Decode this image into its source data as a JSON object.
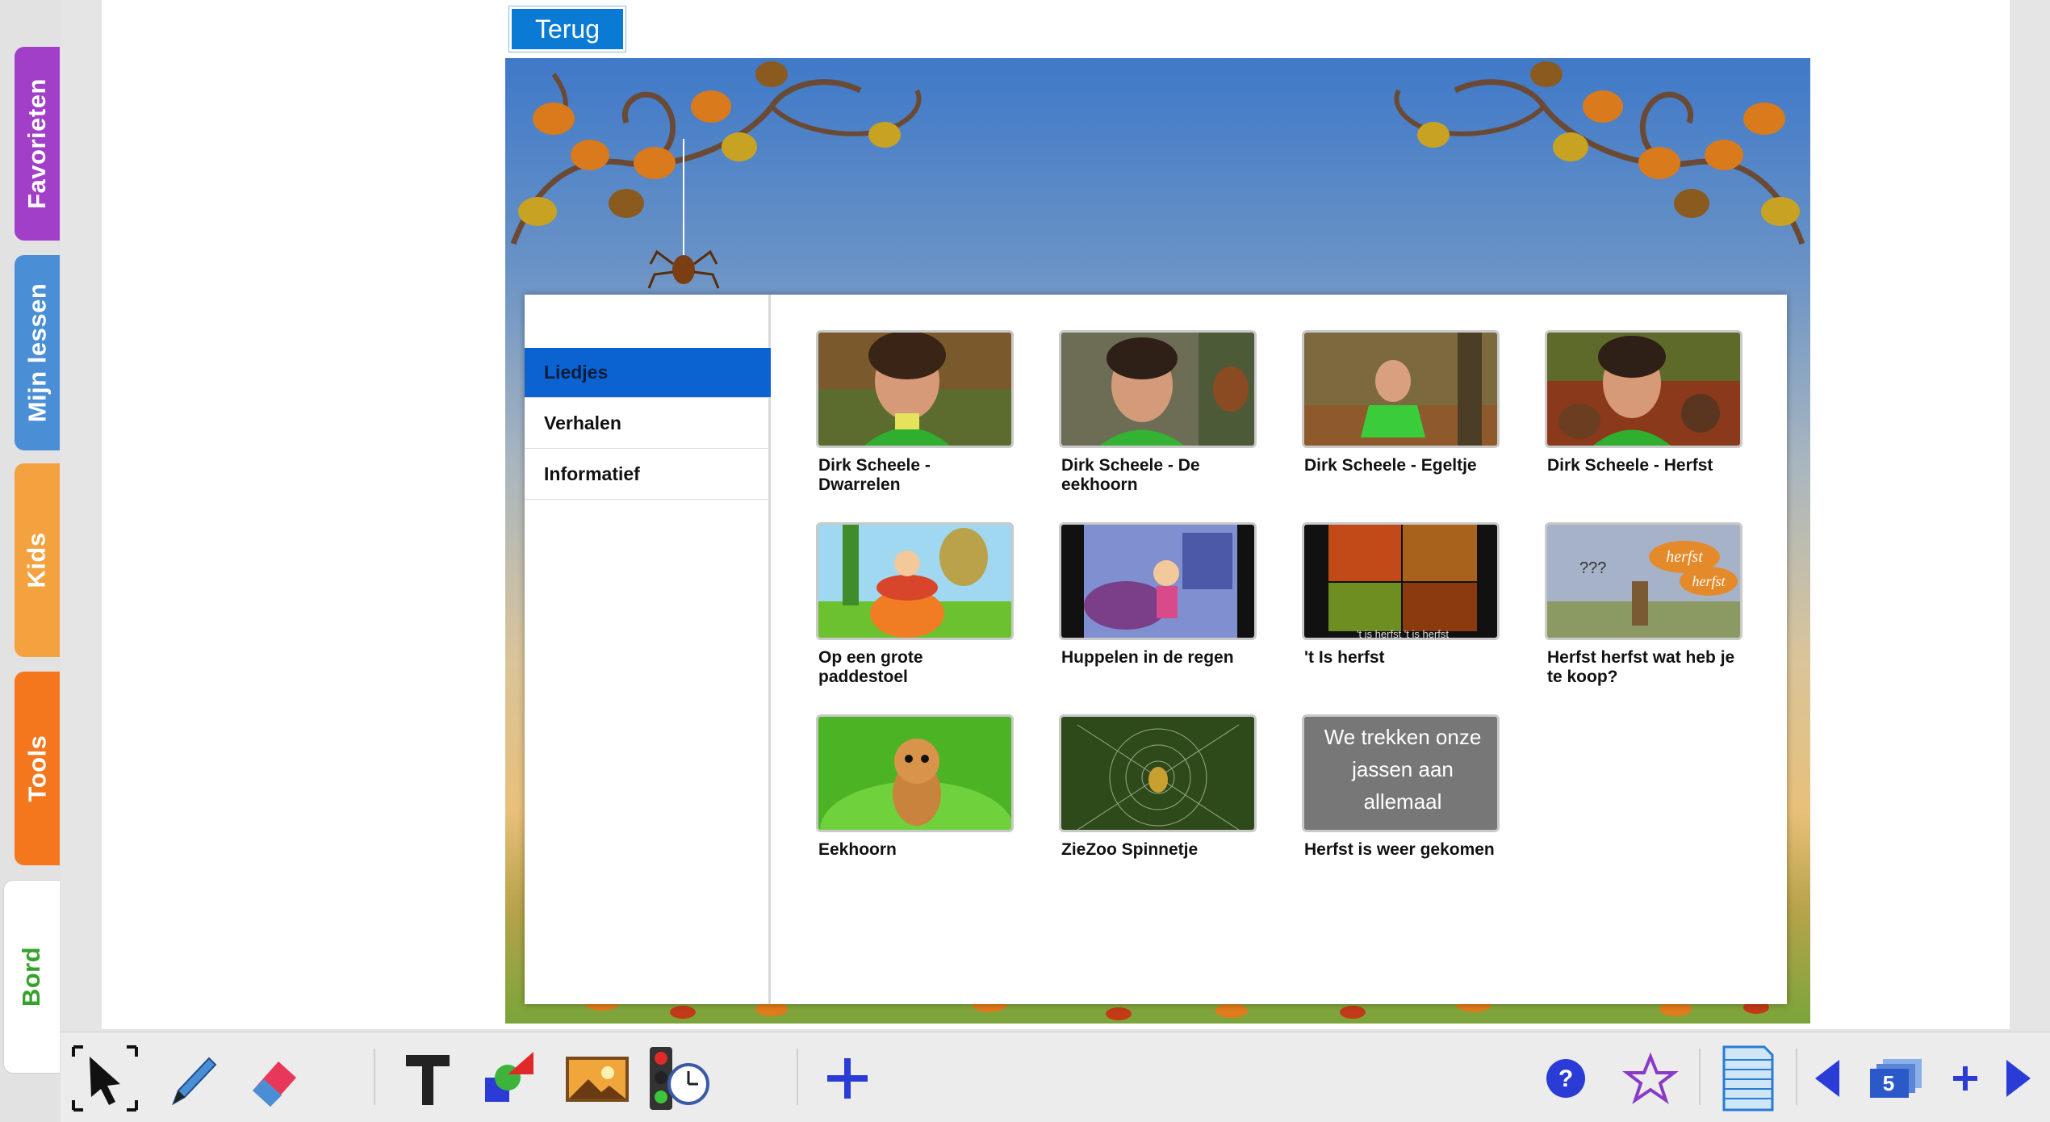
{
  "side_tabs": [
    {
      "label": "Favorieten"
    },
    {
      "label": "Mijn lessen"
    },
    {
      "label": "Kids"
    },
    {
      "label": "Tools"
    },
    {
      "label": "Bord"
    }
  ],
  "back_button": {
    "label": "Terug"
  },
  "categories": [
    {
      "label": "Liedjes",
      "active": true
    },
    {
      "label": "Verhalen",
      "active": false
    },
    {
      "label": "Informatief",
      "active": false
    }
  ],
  "videos": [
    {
      "title": "Dirk Scheele - Dwarrelen"
    },
    {
      "title": "Dirk Scheele - De eekhoorn"
    },
    {
      "title": "Dirk Scheele - Egeltje"
    },
    {
      "title": "Dirk Scheele - Herfst"
    },
    {
      "title": "Op een grote paddestoel"
    },
    {
      "title": "Huppelen in de regen"
    },
    {
      "title": "'t Is herfst"
    },
    {
      "title": "Herfst herfst wat heb je te koop?"
    },
    {
      "title": "Eekhoorn"
    },
    {
      "title": "ZieZoo Spinnetje"
    },
    {
      "title": "Herfst is weer gekomen"
    }
  ],
  "thumb_text": {
    "t_is_herfst": "'t is herfst   't is herfst",
    "herfst_1": "herfst",
    "herfst_2": "herfst",
    "question_marks": "???",
    "jassen_line1": "We trekken onze",
    "jassen_line2": "jassen aan",
    "jassen_line3": "allemaal"
  },
  "toolbar": {
    "page_number": "5",
    "icons": [
      "select-arrow-icon",
      "pen-icon",
      "eraser-icon",
      "text-icon",
      "shapes-icon",
      "image-icon",
      "traffic-light-timer-icon",
      "add-icon",
      "help-icon",
      "star-icon",
      "page-list-icon",
      "previous-page-icon",
      "pages-icon",
      "add-page-icon",
      "next-page-icon"
    ]
  },
  "colors": {
    "accent_blue": "#0b63d2",
    "tab_favorieten": "#a23fc9",
    "tab_mijn_lessen": "#4a8fd6",
    "tab_kids": "#f4a23f",
    "tab_tools": "#f5771d",
    "tab_bord_text": "#35a22b"
  }
}
